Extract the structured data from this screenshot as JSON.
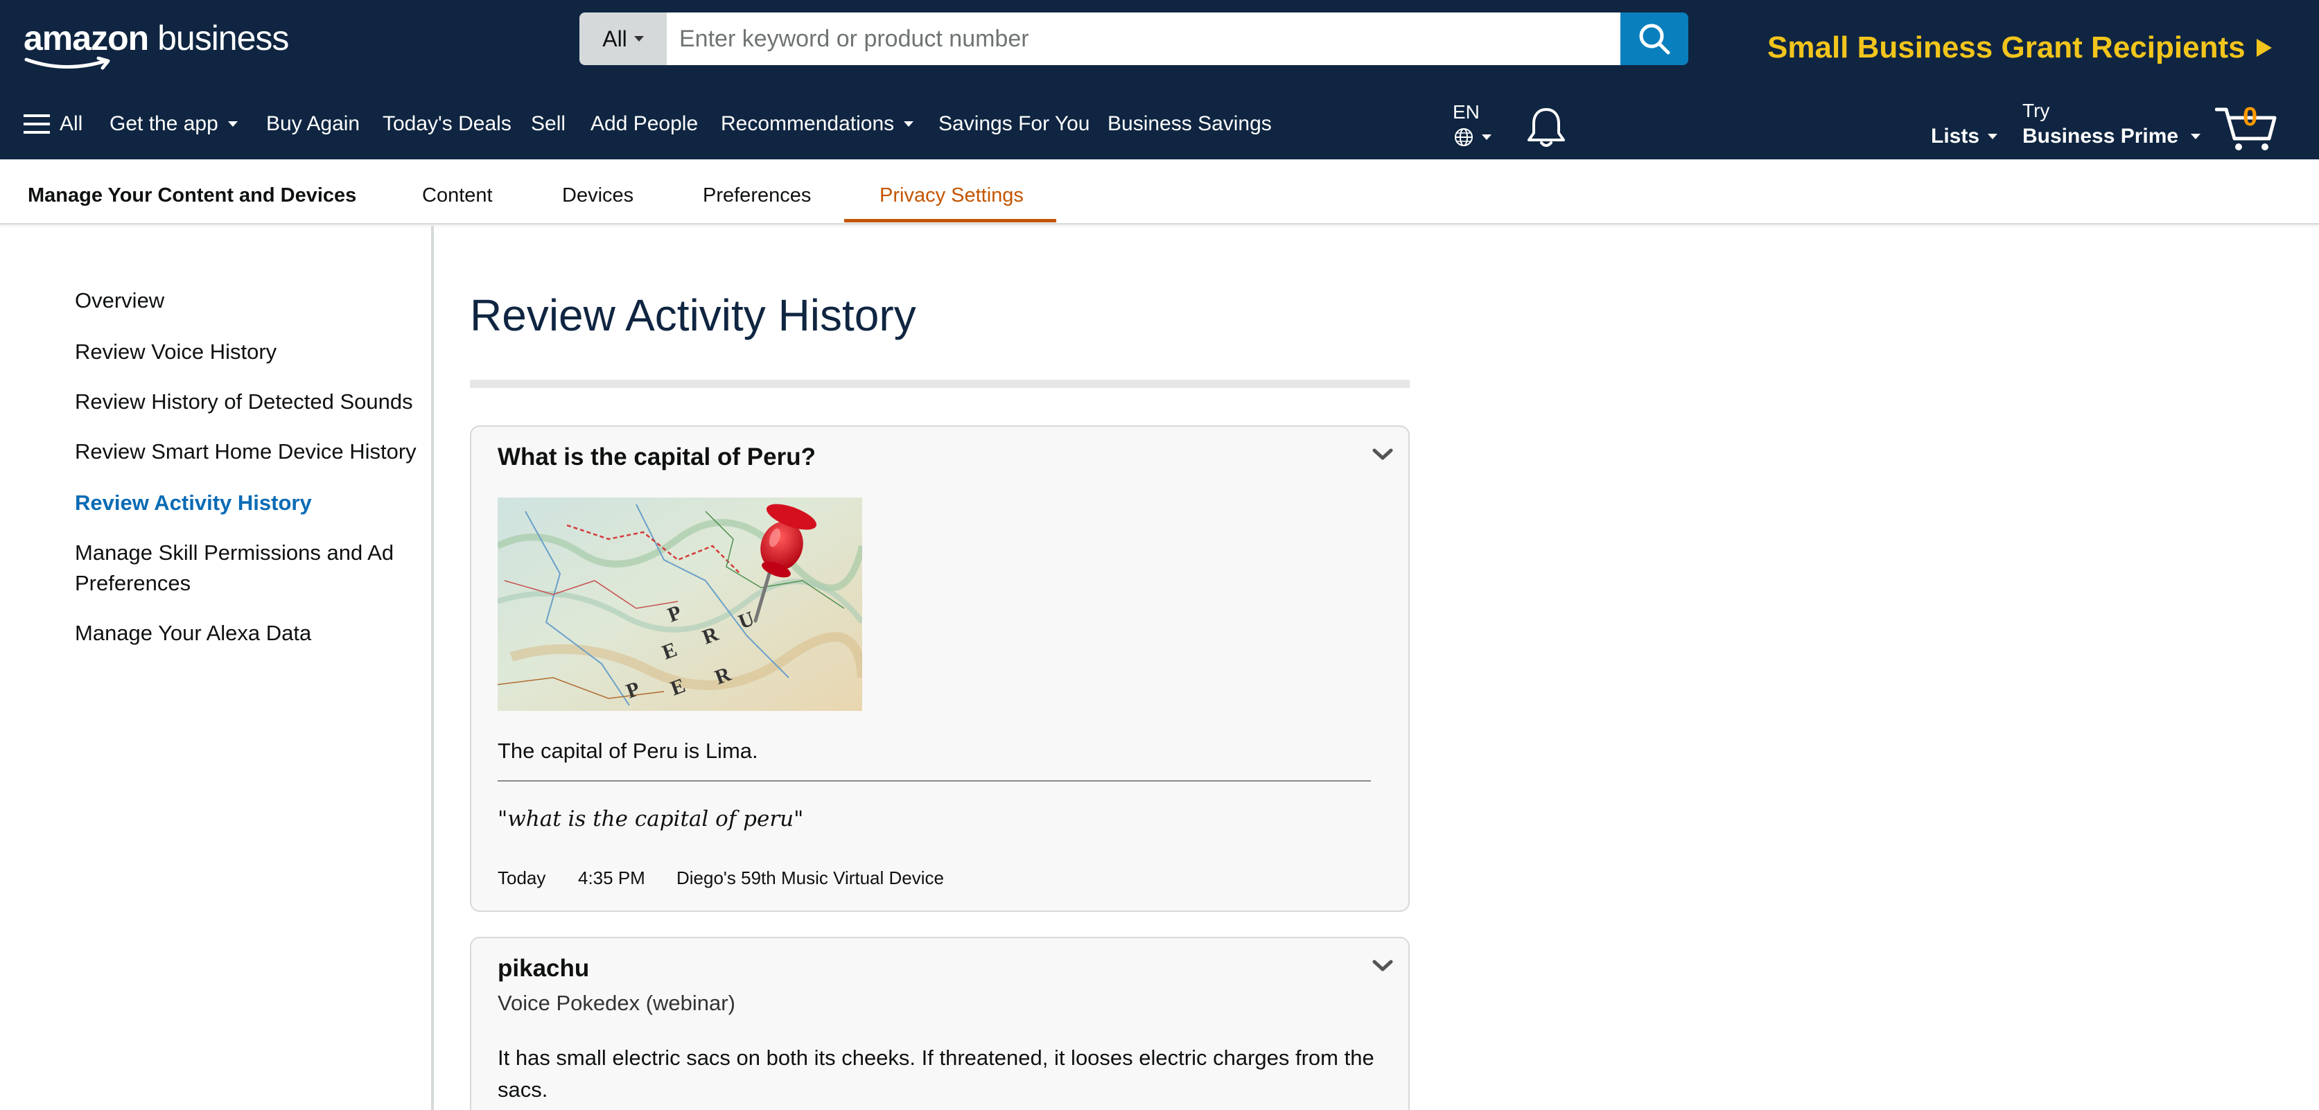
{
  "header": {
    "logo_main": "amazon",
    "logo_sub": "business",
    "search": {
      "category": "All",
      "placeholder": "Enter keyword or product number"
    },
    "promo": "Small Business Grant Recipients",
    "nav": {
      "all": "All",
      "get_app": "Get the app",
      "buy_again": "Buy Again",
      "todays_deals": "Today's Deals",
      "sell": "Sell",
      "add_people": "Add People",
      "recommendations": "Recommendations",
      "savings_for_you": "Savings For You",
      "business_savings": "Business Savings"
    },
    "language": "EN",
    "lists": "Lists",
    "try": "Try",
    "business_prime": "Business Prime",
    "cart_count": "0"
  },
  "subnav": {
    "title": "Manage Your Content and Devices",
    "tabs": [
      "Content",
      "Devices",
      "Preferences",
      "Privacy Settings"
    ],
    "active_tab": "Privacy Settings"
  },
  "sidebar": {
    "items": [
      "Overview",
      "Review Voice History",
      "Review History of Detected Sounds",
      "Review Smart Home Device History",
      "Review Activity History",
      "Manage Skill Permissions and Ad Preferences",
      "Manage Your Alexa Data"
    ],
    "active": "Review Activity History"
  },
  "main": {
    "title": "Review Activity History",
    "cards": [
      {
        "question": "What is the capital of Peru?",
        "answer": "The capital of Peru is Lima.",
        "utterance": "\"what is the capital of peru\"",
        "day": "Today",
        "time": "4:35 PM",
        "device": "Diego's 59th Music Virtual Device"
      },
      {
        "question": "pikachu",
        "skill": "Voice Pokedex (webinar)",
        "answer": "It has small electric sacs on both its cheeks. If threatened, it looses electric charges from the sacs."
      }
    ]
  },
  "colors": {
    "header_bg": "#0f2541",
    "search_button": "#0a7fbd",
    "promo": "#f2c51c",
    "active_tab": "#c45500",
    "active_link": "#0a6bb5",
    "cart_count": "#ff9900"
  }
}
